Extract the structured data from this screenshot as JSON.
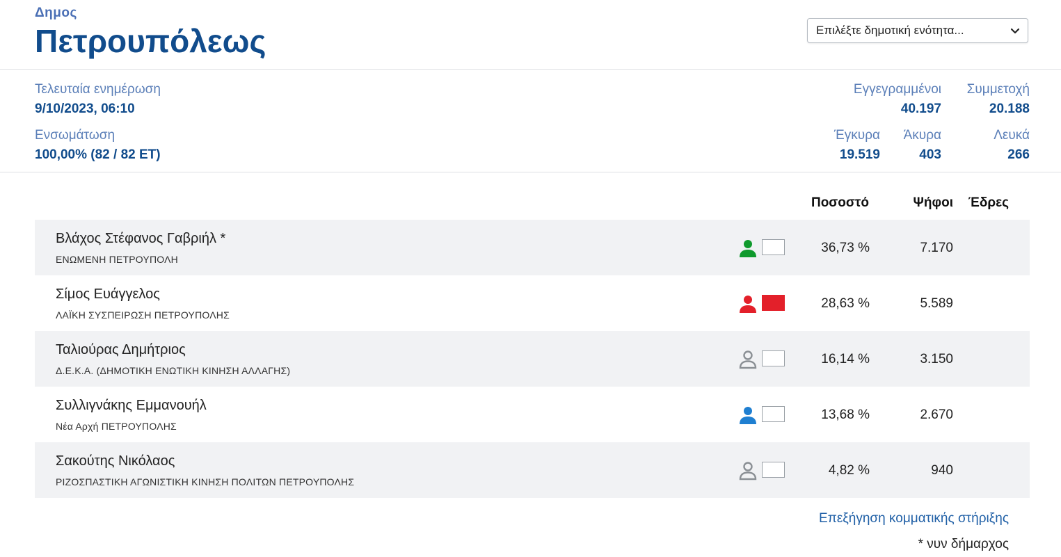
{
  "header": {
    "muni_label": "Δημος",
    "muni_name": "Πετρουπόλεως",
    "unit_select": {
      "value": "Επιλέξτε δημοτική ενότητα..."
    }
  },
  "stats": {
    "last_update_label": "Τελευταία ενημέρωση",
    "last_update_value": "9/10/2023, 06:10",
    "integration_label": "Ενσωμάτωση",
    "integration_value": "100,00% (82 / 82 ΕΤ)",
    "registered_label": "Εγγεγραμμένοι",
    "registered_value": "40.197",
    "turnout_label": "Συμμετοχή",
    "turnout_value": "20.188",
    "valid_label": "Έγκυρα",
    "valid_value": "19.519",
    "invalid_label": "Άκυρα",
    "invalid_value": "403",
    "blank_label": "Λευκά",
    "blank_value": "266"
  },
  "table": {
    "col_percent": "Ποσοστό",
    "col_votes": "Ψήφοι",
    "col_seats": "Έδρες",
    "rows": [
      {
        "candidate": "Βλάχος Στέφανος Γαβριήλ *",
        "party": "ΕΝΩΜΕΝΗ ΠΕΤΡΟΥΠΟΛΗ",
        "percent": "36,73 %",
        "votes": "7.170",
        "seats": "",
        "icon": "person-icon",
        "icon_color": "#0f9a2c",
        "swatch_color": "#ffffff"
      },
      {
        "candidate": "Σίμος Ευάγγελος",
        "party": "ΛΑΪΚΗ ΣΥΣΠΕΙΡΩΣΗ ΠΕΤΡΟΥΠΟΛΗΣ",
        "percent": "28,63 %",
        "votes": "5.589",
        "seats": "",
        "icon": "person-icon",
        "icon_color": "#e3202a",
        "swatch_color": "#e3202a"
      },
      {
        "candidate": "Ταλιούρας Δημήτριος",
        "party": "Δ.Ε.Κ.Α. (ΔΗΜΟΤΙΚΗ ΕΝΩΤΙΚΗ ΚΙΝΗΣΗ ΑΛΛΑΓΗΣ)",
        "percent": "16,14 %",
        "votes": "3.150",
        "seats": "",
        "icon": "person-outline-icon",
        "icon_color": "#8a8f94",
        "swatch_color": "#ffffff"
      },
      {
        "candidate": "Συλλιγνάκης Εμμανουήλ",
        "party": "Νέα Αρχή ΠΕΤΡΟΥΠΟΛΗΣ",
        "percent": "13,68 %",
        "votes": "2.670",
        "seats": "",
        "icon": "person-icon",
        "icon_color": "#1f7fd1",
        "swatch_color": "#ffffff"
      },
      {
        "candidate": "Σακούτης Νικόλαος",
        "party": "ΡΙΖΟΣΠΑΣΤΙΚΗ ΑΓΩΝΙΣΤΙΚΗ ΚΙΝΗΣΗ ΠΟΛΙΤΩΝ ΠΕΤΡΟΥΠΟΛΗΣ",
        "percent": "4,82 %",
        "votes": "940",
        "seats": "",
        "icon": "person-outline-icon",
        "icon_color": "#8a8f94",
        "swatch_color": "#ffffff"
      }
    ]
  },
  "footer": {
    "explain_link": "Επεξήγηση κομματικής στήριξης",
    "footnote": "* νυν δήμαρχος"
  }
}
